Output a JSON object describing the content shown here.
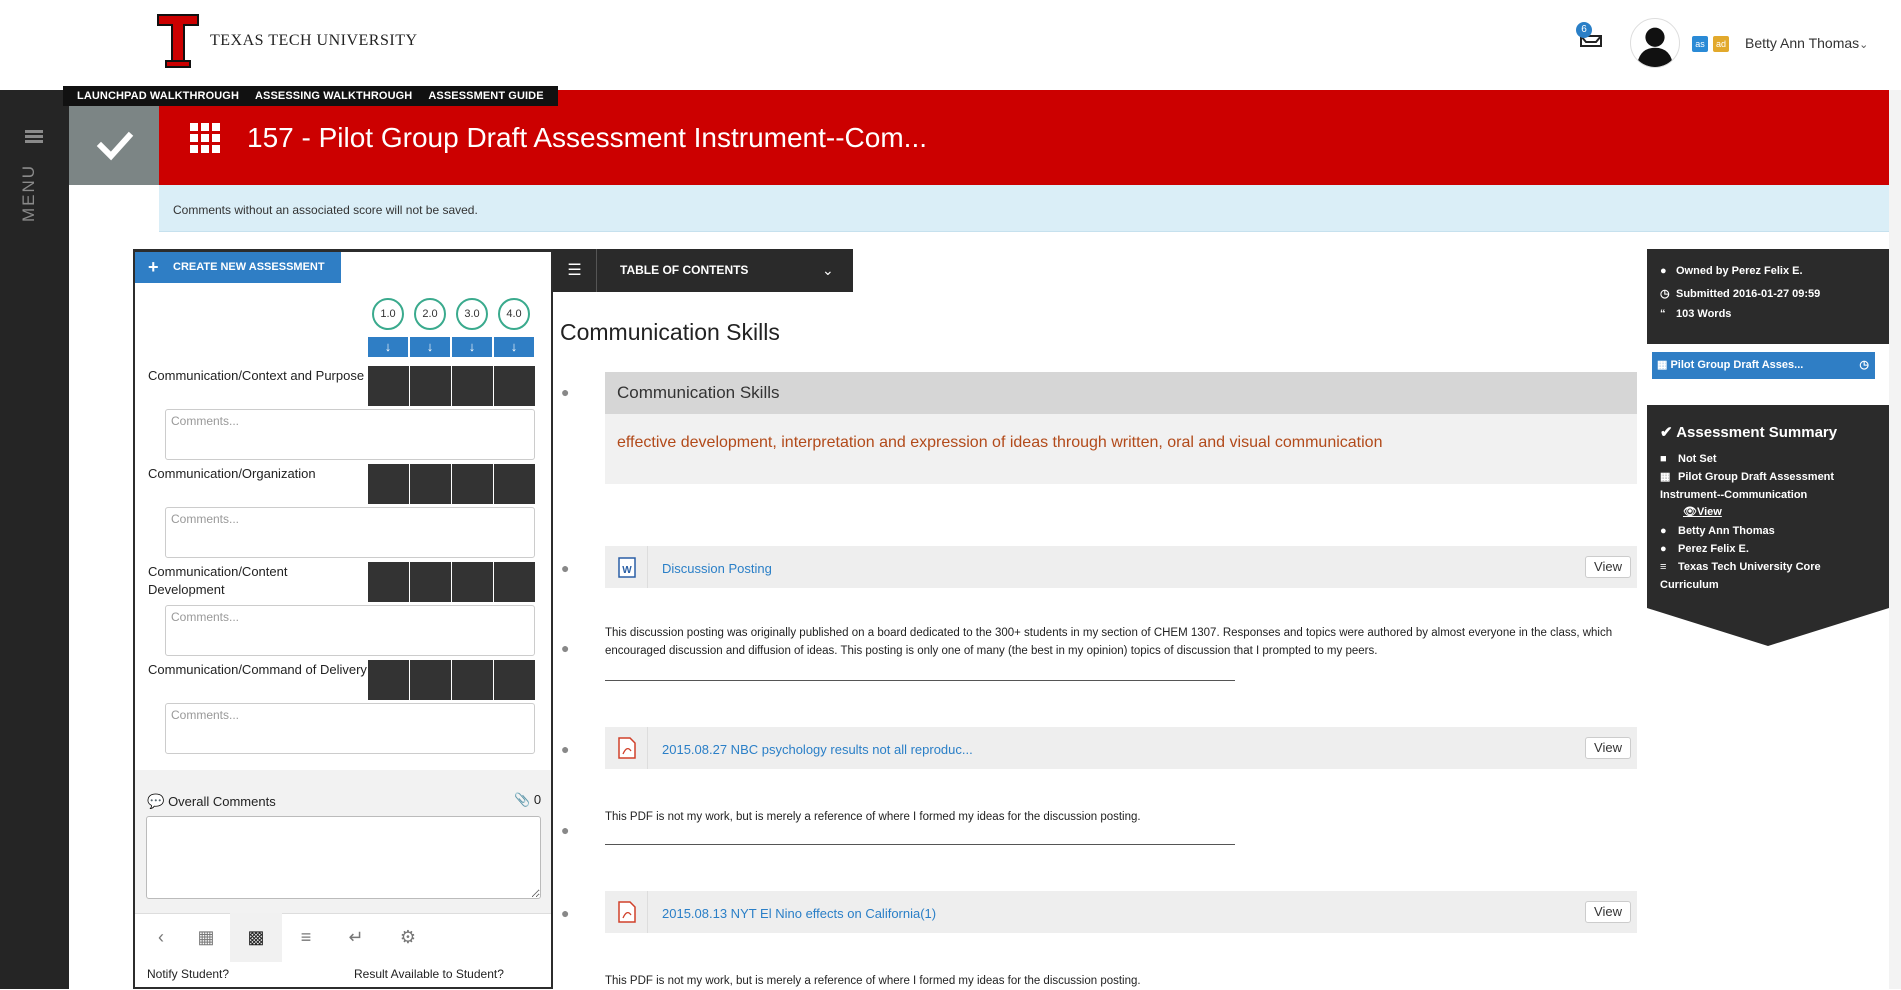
{
  "header": {
    "university": "TEXAS TECH UNIVERSITY",
    "notifications_count": "6",
    "tag_as": "as",
    "tag_ad": "ad",
    "user_name": "Betty Ann Thomas"
  },
  "menu": {
    "label": "MENU"
  },
  "walkthroughs": [
    "LAUNCHPAD WALKTHROUGH",
    "ASSESSING WALKTHROUGH",
    "ASSESSMENT GUIDE"
  ],
  "title": "157 - Pilot Group Draft Assessment Instrument--Com...",
  "info_message": "Comments without an associated score will not be saved.",
  "scoring": {
    "create_label": "CREATE NEW ASSESSMENT",
    "scores": [
      "1.0",
      "2.0",
      "3.0",
      "4.0"
    ],
    "criteria": [
      {
        "label": "Communication/Context and Purpose"
      },
      {
        "label": "Communication/Organization"
      },
      {
        "label": "Communication/Content Development"
      },
      {
        "label": "Communication/Command of Delivery"
      }
    ],
    "comment_placeholder": "Comments...",
    "overall_label": "Overall Comments",
    "attachments": "0",
    "notify_label": "Notify Student?",
    "result_label": "Result Available to Student?"
  },
  "toc": {
    "label": "TABLE OF CONTENTS"
  },
  "content": {
    "section_title": "Communication Skills",
    "card_title": "Communication Skills",
    "card_body": "effective development, interpretation and expression of ideas through written, oral and visual communication",
    "view_label": "View",
    "files": [
      {
        "name": "Discussion Posting",
        "type": "word",
        "desc": "This discussion posting was originally published on a board dedicated to the 300+ students in my section of CHEM 1307. Responses and topics were authored by almost everyone in the class, which encouraged discussion and diffusion of ideas. This posting is only one of many (the best in my opinion) topics of discussion that I prompted to my peers."
      },
      {
        "name": "2015.08.27 NBC psychology results not all reproduc...",
        "type": "pdf",
        "desc": "This PDF is not my work, but is merely a reference of where I formed my ideas for the discussion posting."
      },
      {
        "name": "2015.08.13 NYT El Nino effects on California(1)",
        "type": "pdf",
        "desc": "This PDF is not my work, but is merely a reference of where I formed my ideas for the discussion posting."
      }
    ]
  },
  "owner": {
    "owned_by": "Owned by Perez Felix E.",
    "submitted": "Submitted   2016-01-27 09:59",
    "words": "103 Words",
    "link": "Pilot Group Draft Asses..."
  },
  "summary": {
    "title": "Assessment Summary",
    "status": "Not Set",
    "instrument": "Pilot Group Draft Assessment Instrument--Communication",
    "view": "View",
    "assessor": "Betty Ann Thomas",
    "owner": "Perez Felix E.",
    "curriculum": "Texas Tech University Core Curriculum"
  },
  "colors": {
    "accent_red": "#cc0000",
    "accent_blue": "#2f7ec5",
    "score_ring": "#3aaa8d"
  }
}
